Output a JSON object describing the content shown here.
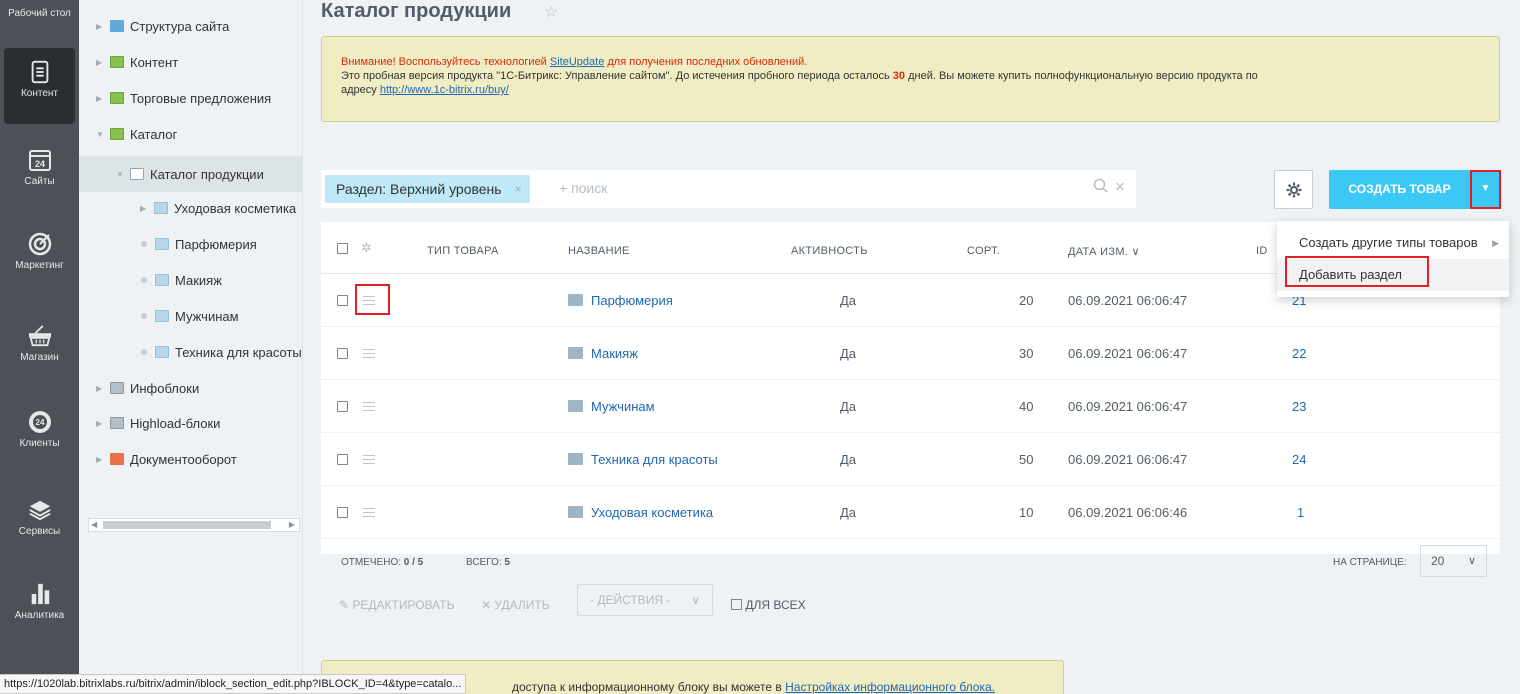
{
  "left_menu": [
    {
      "label": "Рабочий стол",
      "icon": "desktop-icon"
    },
    {
      "label": "Контент",
      "icon": "document-icon",
      "active": true
    },
    {
      "label": "Сайты",
      "icon": "calendar-24-icon"
    },
    {
      "label": "Маркетинг",
      "icon": "target-icon"
    },
    {
      "label": "Магазин",
      "icon": "basket-icon"
    },
    {
      "label": "Клиенты",
      "icon": "clients-24-icon"
    },
    {
      "label": "Сервисы",
      "icon": "layers-icon"
    },
    {
      "label": "Аналитика",
      "icon": "bar-chart-icon"
    }
  ],
  "tree": [
    {
      "label": "Структура сайта"
    },
    {
      "label": "Контент"
    },
    {
      "label": "Торговые предложения"
    },
    {
      "label": "Каталог"
    },
    {
      "label": "Каталог продукции"
    },
    {
      "label": "Уходовая косметика"
    },
    {
      "label": "Парфюмерия"
    },
    {
      "label": "Макияж"
    },
    {
      "label": "Мужчинам"
    },
    {
      "label": "Техника для красоты"
    },
    {
      "label": "Инфоблоки"
    },
    {
      "label": "Highload-блоки"
    },
    {
      "label": "Документооборот"
    }
  ],
  "page": {
    "title": "Каталог продукции"
  },
  "warning": {
    "line1_prefix": "Внимание! Воспользуйтесь технологией ",
    "line1_link": "SiteUpdate",
    "line1_suffix": " для получения последних обновлений.",
    "line2_prefix": "Это пробная версия продукта \"1С-Битрикс: Управление сайтом\". До истечения пробного периода осталось ",
    "days": "30",
    "line2_suffix": " дней. Вы можете купить полнофункциональную версию продукта по",
    "line3_prefix": "адресу ",
    "line3_link": "http://www.1c-bitrix.ru/buy/"
  },
  "filter": {
    "chip_label": "Раздел: Верхний уровень",
    "chip_close": "×",
    "search_placeholder": "+ поиск",
    "search_icon": "Q",
    "clear_icon": "×"
  },
  "toolbar": {
    "gear_icon": "✿",
    "create_label": "СОЗДАТЬ ТОВАР",
    "arrow": "▼"
  },
  "popup": {
    "item1": "Создать другие типы товаров",
    "item1_arrow": "▶",
    "item2": "Добавить раздел"
  },
  "grid": {
    "headers": {
      "type": "ТИП ТОВАРА",
      "name": "НАЗВАНИЕ",
      "active": "АКТИВНОСТЬ",
      "sort": "СОРТ.",
      "date": "ДАТА ИЗМ. ∨",
      "id": "ID"
    },
    "rows": [
      {
        "name": "Парфюмерия",
        "active": "Да",
        "sort": "20",
        "date": "06.09.2021 06:06:47",
        "id": "21"
      },
      {
        "name": "Макияж",
        "active": "Да",
        "sort": "30",
        "date": "06.09.2021 06:06:47",
        "id": "22"
      },
      {
        "name": "Мужчинам",
        "active": "Да",
        "sort": "40",
        "date": "06.09.2021 06:06:47",
        "id": "23"
      },
      {
        "name": "Техника для красоты",
        "active": "Да",
        "sort": "50",
        "date": "06.09.2021 06:06:47",
        "id": "24"
      },
      {
        "name": "Уходовая косметика",
        "active": "Да",
        "sort": "10",
        "date": "06.09.2021 06:06:46",
        "id": "1"
      }
    ],
    "footer": {
      "checked_label": "ОТМЕЧЕНО:",
      "checked_value": "0 / 5",
      "total_label": "ВСЕГО:",
      "total_value": "5",
      "per_page_label": "НА СТРАНИЦЕ:",
      "per_page_value": "20"
    }
  },
  "actions": {
    "edit": "РЕДАКТИРОВАТЬ",
    "delete": "УДАЛИТЬ",
    "select": "- ДЕЙСТВИЯ -",
    "for_all": "ДЛЯ ВСЕХ"
  },
  "bottom_warning": {
    "text": "доступа к информационному блоку вы можете в ",
    "link": "Настройках информационного блока."
  },
  "status_url": "https://1020lab.bitrixlabs.ru/bitrix/admin/iblock_section_edit.php?IBLOCK_ID=4&type=catalo..."
}
